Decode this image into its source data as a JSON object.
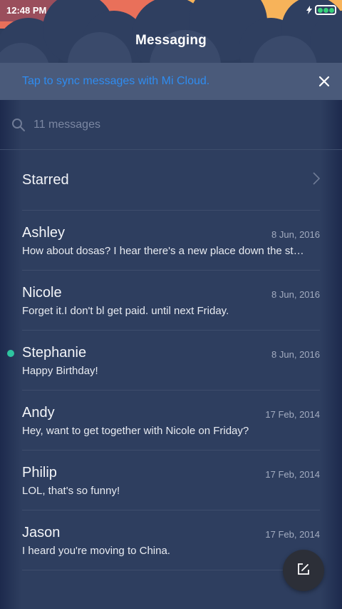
{
  "status_bar": {
    "time": "12:48 PM"
  },
  "header": {
    "title": "Messaging"
  },
  "sync_banner": {
    "text": "Tap to sync messages with Mi Cloud."
  },
  "search": {
    "placeholder": "11 messages"
  },
  "starred": {
    "label": "Starred"
  },
  "messages": [
    {
      "name": "Ashley",
      "date": "8 Jun, 2016",
      "preview": "How about dosas? I hear there's a new place down the st…",
      "unread": false
    },
    {
      "name": "Nicole",
      "date": "8 Jun, 2016",
      "preview": "Forget it.I don't bl get paid. until next Friday.",
      "unread": false
    },
    {
      "name": "Stephanie",
      "date": "8 Jun, 2016",
      "preview": "Happy Birthday!",
      "unread": true
    },
    {
      "name": "Andy",
      "date": "17 Feb, 2014",
      "preview": "Hey, want to get together with Nicole on Friday?",
      "unread": false
    },
    {
      "name": "Philip",
      "date": "17 Feb, 2014",
      "preview": "LOL, that's so funny!",
      "unread": false
    },
    {
      "name": "Jason",
      "date": "17 Feb, 2014",
      "preview": "I heard you're moving to China.",
      "unread": false
    }
  ],
  "icons": {
    "search": "search-icon",
    "close": "close-icon",
    "chevron": "chevron-right-icon",
    "compose": "compose-icon",
    "charging": "charging-icon",
    "battery": "battery-icon"
  },
  "colors": {
    "background": "#2e3e5f",
    "banner": "#4a5a7a",
    "link": "#2f8cf0",
    "unread_dot": "#2ec4a0",
    "fab": "#2c2f38"
  }
}
